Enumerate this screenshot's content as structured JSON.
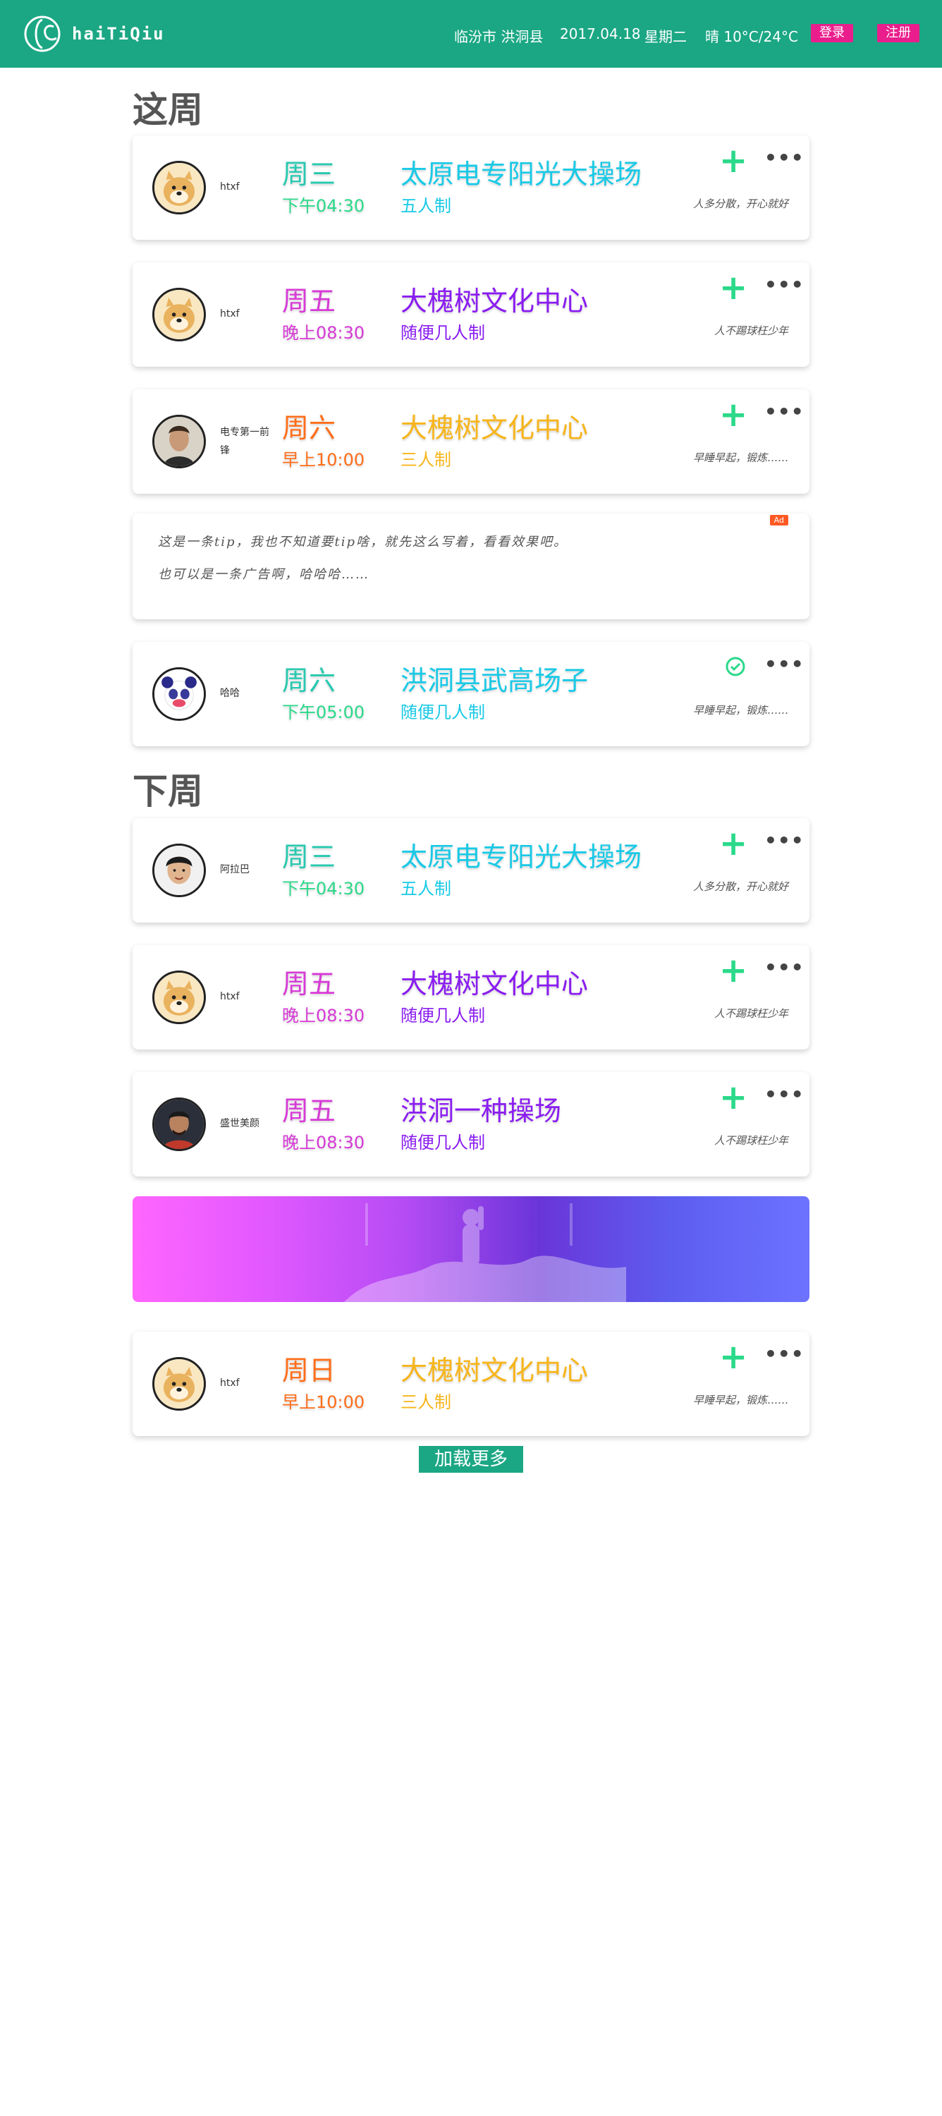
{
  "header": {
    "brand": "haiTiQiu",
    "city": "临汾市 洪洞县",
    "date": "2017.04.18",
    "weekday": "星期二",
    "weather": "晴 10°C/24°C",
    "login": "登录",
    "register": "注册",
    "bg_color": "#1ba784"
  },
  "sections": {
    "this_week": "这周",
    "next_week": "下周"
  },
  "this_week_cards": [
    {
      "user": "htxf",
      "day": "周三",
      "time": "下午04:30",
      "venue": "太原电专阳光大操场",
      "rule": "五人制",
      "slogan": "人多分散，开心就好",
      "action": "plus-icon"
    },
    {
      "user": "htxf",
      "day": "周五",
      "time": "晚上08:30",
      "venue": "大槐树文化中心",
      "rule": "随便几人制",
      "slogan": "人不踢球枉少年",
      "action": "plus-icon"
    },
    {
      "user": "电专第一前锋",
      "day": "周六",
      "time": "早上10:00",
      "venue": "大槐树文化中心",
      "rule": "三人制",
      "slogan": "早睡早起，锻炼……",
      "action": "plus-icon"
    },
    {
      "user": "哈哈",
      "day": "周六",
      "time": "下午05:00",
      "venue": "洪洞县武高场子",
      "rule": "随便几人制",
      "slogan": "早睡早起，锻炼……",
      "action": "check-circle-icon"
    }
  ],
  "tip": {
    "line1": "这是一条tip，我也不知道要tip啥，就先这么写着，看看效果吧。",
    "line2": "也可以是一条广告啊，哈哈哈……",
    "ad_label": "Ad"
  },
  "next_week_cards": [
    {
      "user": "阿拉巴",
      "day": "周三",
      "time": "下午04:30",
      "venue": "太原电专阳光大操场",
      "rule": "五人制",
      "slogan": "人多分散，开心就好",
      "action": "plus-icon"
    },
    {
      "user": "htxf",
      "day": "周五",
      "time": "晚上08:30",
      "venue": "大槐树文化中心",
      "rule": "随便几人制",
      "slogan": "人不踢球枉少年",
      "action": "plus-icon"
    },
    {
      "user": "盛世美颜",
      "day": "周五",
      "time": "晚上08:30",
      "venue": "洪洞一种操场",
      "rule": "随便几人制",
      "slogan": "人不踢球枉少年",
      "action": "plus-icon"
    },
    {
      "user": "htxf",
      "day": "周日",
      "time": "早上10:00",
      "venue": "大槐树文化中心",
      "rule": "三人制",
      "slogan": "早睡早起，锻炼……",
      "action": "plus-icon"
    }
  ],
  "more_icon_text": "•••",
  "plus_text": "+",
  "load_more": "加载更多"
}
